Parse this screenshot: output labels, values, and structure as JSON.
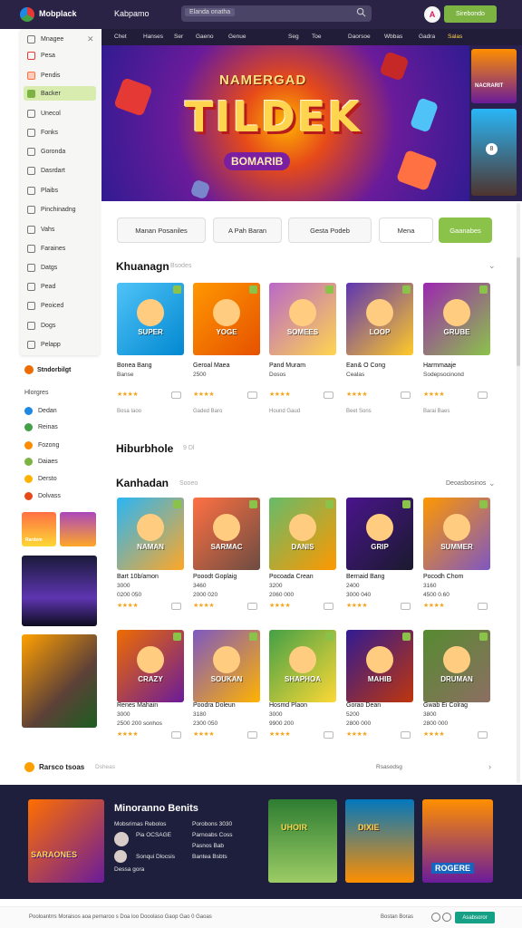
{
  "header": {
    "logo": "Mobplack",
    "title": "Kabpamo",
    "search_tag": "Elanda onatha",
    "avatar": "A",
    "signup_label": "Sirebondo"
  },
  "subnav": [
    "Chet",
    "Hanses",
    "Ser",
    "Gaeno",
    "Genue",
    "Seg",
    "Toe",
    "Daorsoe",
    "Wbbas",
    "Gadra",
    "Salas"
  ],
  "sidebar": {
    "items": [
      "Mnagee",
      "Pesa",
      "Pendis",
      "Backer",
      "Unecol",
      "Fonks",
      "Goronda",
      "Dasrdart",
      "Plaibs",
      "Pinchinadng",
      "Vahs",
      "Faraines",
      "Datgs",
      "Pead",
      "Peoiced",
      "Dogs",
      "Pelapp"
    ],
    "category_title": "Stndorbilgt",
    "sub_label": "Hlorgres",
    "categories": [
      "Dedan",
      "Reinas",
      "Fozong",
      "Daiaes",
      "Dersto",
      "Dolvass"
    ],
    "promo_tag": "Rardem"
  },
  "hero": {
    "subtitle": "NAMERGAD",
    "title": "TILDEK",
    "tag": "BOMARIB",
    "side_label": "NACRARIT",
    "badge": "8"
  },
  "filters": [
    "Manan Posaniles",
    "A Pah Baran",
    "Gesta Podeb",
    "Mena",
    "Gaanabes"
  ],
  "section1": {
    "title": "Khuanagn",
    "sub": "Bsodes",
    "games": [
      {
        "name": "Bonea Bang",
        "meta": "Banse",
        "foot": "Bosa Iaoo",
        "art": "SUPER"
      },
      {
        "name": "Geroal Maea",
        "meta": "2500",
        "foot": "Gaded Baro",
        "art": "YOGE"
      },
      {
        "name": "Pand Muram",
        "meta": "Dosos",
        "foot": "Hound Gaud",
        "art": "SOMEES"
      },
      {
        "name": "Ean& O Cong",
        "meta": "Cealas",
        "foot": "Beet Sons",
        "art": "LOOP"
      },
      {
        "name": "Harmmaaje",
        "meta": "Sodepsocinond",
        "foot": "Barai Baes",
        "art": "GRUBE"
      }
    ]
  },
  "section2": {
    "title": "Hiburbhole",
    "sub": "9 Dl"
  },
  "section3": {
    "title": "Kanhadan",
    "sub": "Sooeo",
    "right": "Deoasbosinos",
    "row1": [
      {
        "name": "Bart 10b/amon",
        "meta": "3000",
        "foot": "0200 050",
        "art": "NAMAN"
      },
      {
        "name": "Pooodt Goplaig",
        "meta": "3460",
        "foot": "2000 020",
        "art": "SARMAC"
      },
      {
        "name": "Pocoada Crean",
        "meta": "3200",
        "foot": "2060 000",
        "art": "DANIS"
      },
      {
        "name": "Bernaid Bang",
        "meta": "2400",
        "foot": "3000 040",
        "art": "GRIP"
      },
      {
        "name": "Pocodh Chom",
        "meta": "3160",
        "foot": "4500 0.60",
        "art": "SUMMER"
      }
    ],
    "row2": [
      {
        "name": "Renes Mahain",
        "meta": "3000",
        "foot": "2500 200 sonhos",
        "art": "CRAZY"
      },
      {
        "name": "Poodra Doleun",
        "meta": "3180",
        "foot": "2300 050",
        "art": "SOUKAN"
      },
      {
        "name": "Hosmd Plaon",
        "meta": "3000",
        "foot": "9900 200",
        "art": "SHAPHOA"
      },
      {
        "name": "Gorao Dean",
        "meta": "5200",
        "foot": "2800 000",
        "art": "MAHIB"
      },
      {
        "name": "Gwab Ei Colrag",
        "meta": "3800",
        "foot": "2800 000",
        "art": "DRUMAN"
      }
    ]
  },
  "bottom_row": {
    "title": "Rarsco tsoas",
    "sub": "Dsheas",
    "right": "Rsasodsg"
  },
  "footer": {
    "title": "Minoranno Benits",
    "lines": [
      "Mobsrimas Rebolos",
      "Porobons 3030",
      "Pia OCSAGE",
      "Parnoabs Coss",
      "Pasnos Bab",
      "Sonqui Dlocsis",
      "Bantea Bsbts",
      "Dessa gora"
    ],
    "promo_label": "SARAONES",
    "cards": [
      "UHOIR",
      "DIXIE",
      "ROGERE"
    ]
  },
  "bottombar": {
    "left": "Pooloantrrs  Moraisos aoa pernaroo s  Doa loo Dooolaso   Gaop  Gao  0  Gaoas",
    "mid": "Bostan Boras",
    "button": "Asabsoror"
  }
}
